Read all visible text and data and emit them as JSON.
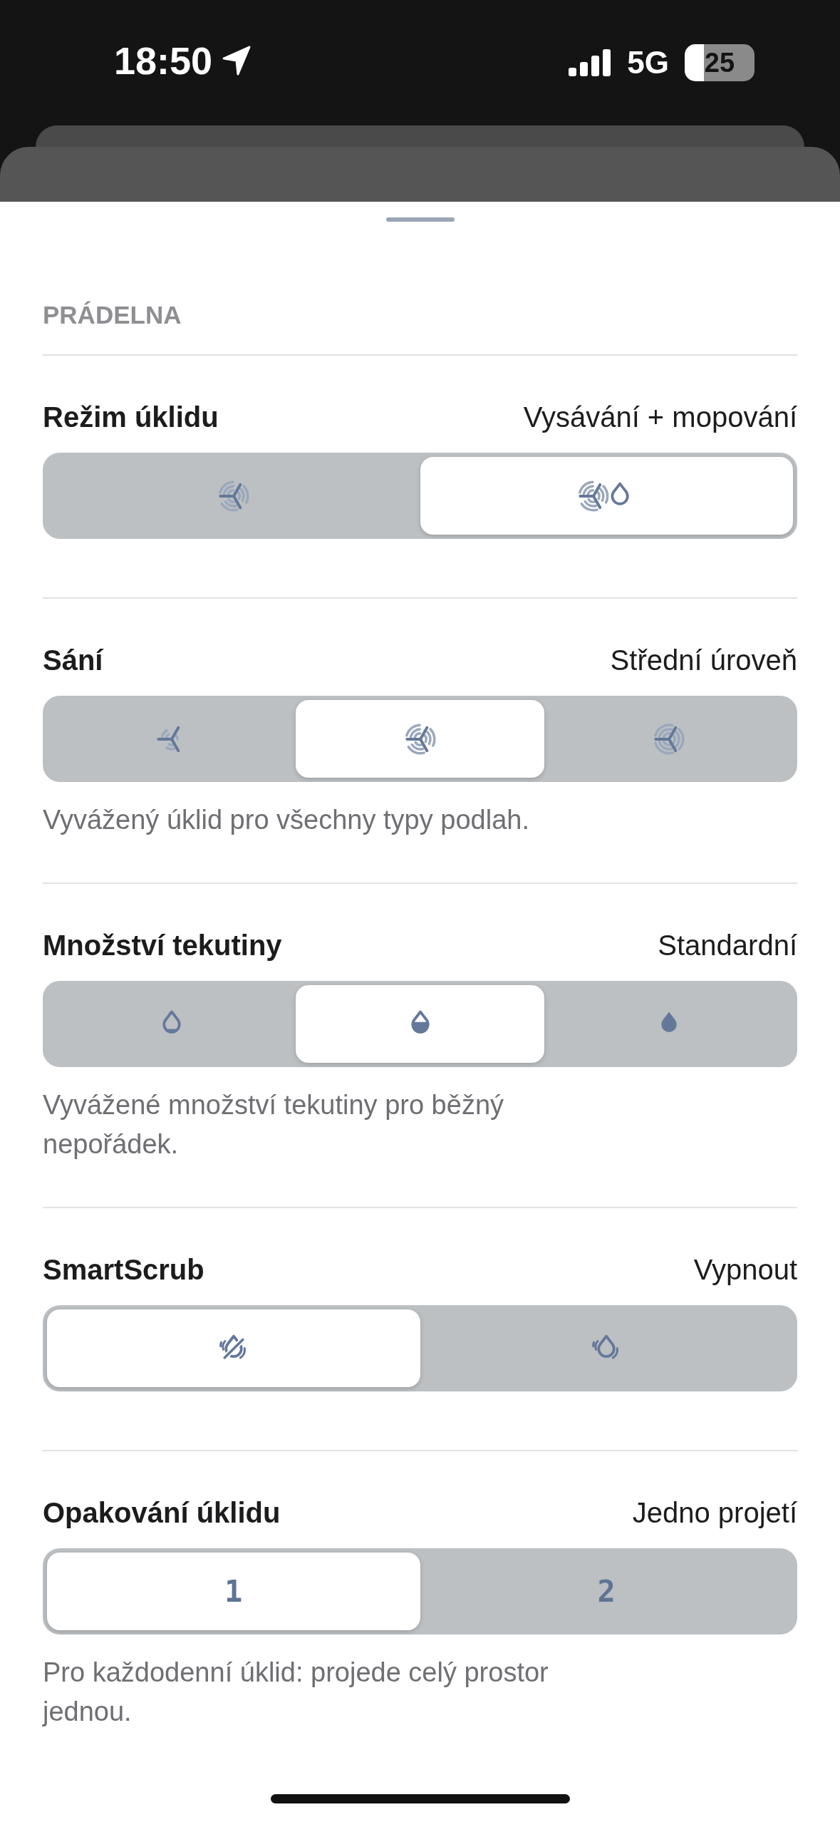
{
  "status_bar": {
    "time": "18:50",
    "network": "5G",
    "battery": "25"
  },
  "section_label": "PRÁDELNA",
  "settings": [
    {
      "title": "Režim úklidu",
      "value": "Vysávání + mopování",
      "options": [
        {
          "kind": "fan-mid",
          "selected": false
        },
        {
          "kind": "fan-drop",
          "selected": true
        }
      ]
    },
    {
      "title": "Sání",
      "value": "Střední úroveň",
      "options": [
        {
          "kind": "fan-low",
          "selected": false
        },
        {
          "kind": "fan-mid",
          "selected": true
        },
        {
          "kind": "fan-high",
          "selected": false
        }
      ],
      "description": "Vyvážený úklid pro všechny typy podlah."
    },
    {
      "title": "Množství tekutiny",
      "value": "Standardní",
      "options": [
        {
          "kind": "drop-low",
          "selected": false
        },
        {
          "kind": "drop-mid",
          "selected": true
        },
        {
          "kind": "drop-high",
          "selected": false
        }
      ],
      "description": "Vyvážené množství tekutiny pro běžný nepořádek."
    },
    {
      "title": "SmartScrub",
      "value": "Vypnout",
      "options": [
        {
          "kind": "scrub-off",
          "selected": true
        },
        {
          "kind": "scrub-on",
          "selected": false
        }
      ]
    },
    {
      "title": "Opakování úklidu",
      "value": "Jedno projetí",
      "options": [
        {
          "kind": "text",
          "label": "1",
          "selected": true
        },
        {
          "kind": "text",
          "label": "2",
          "selected": false
        }
      ],
      "description": "Pro každodenní úklid: projede celý prostor jednou."
    }
  ]
}
